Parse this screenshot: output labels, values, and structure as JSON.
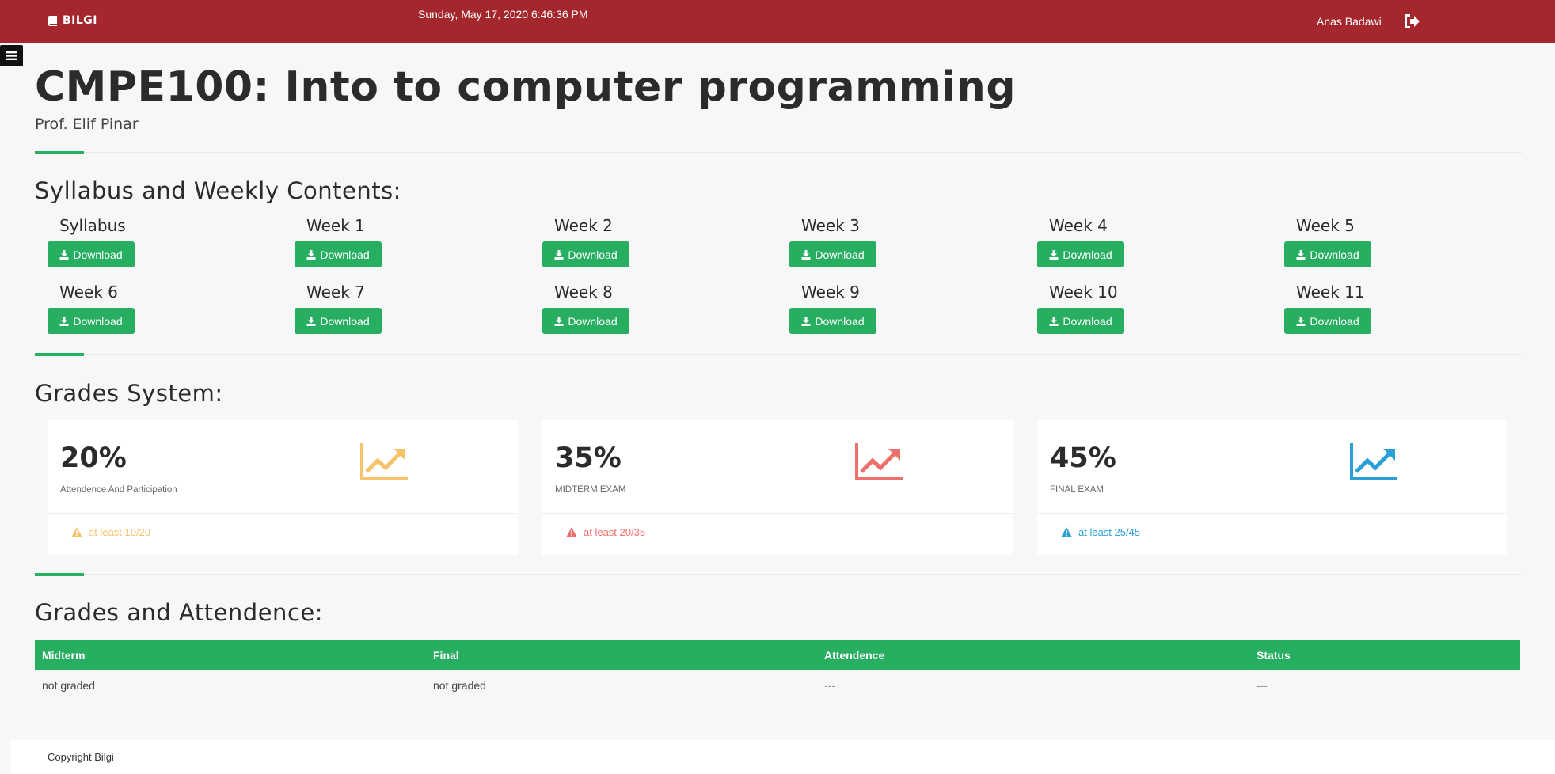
{
  "header": {
    "brand": "BILGI",
    "datetime": "Sunday, May 17, 2020 6:46:36 PM",
    "user": "Anas Badawi"
  },
  "course": {
    "title": "CMPE100: Into to computer programming",
    "professor": "Prof. Elif Pinar"
  },
  "syllabus": {
    "heading": "Syllabus and Weekly Contents:",
    "button_label": "Download",
    "items": [
      "Syllabus",
      "Week 1",
      "Week 2",
      "Week 3",
      "Week 4",
      "Week 5",
      "Week 6",
      "Week 7",
      "Week 8",
      "Week 9",
      "Week 10",
      "Week 11"
    ]
  },
  "grades_system": {
    "heading": "Grades System:",
    "cards": [
      {
        "percent": "20%",
        "label": "Attendence And Participation",
        "note": "at least 10/20",
        "color": "#f6c36b",
        "icon": "line-chart-icon"
      },
      {
        "percent": "35%",
        "label": "MIDTERM EXAM",
        "note": "at least 20/35",
        "color": "#ef6f6c",
        "icon": "line-chart-icon"
      },
      {
        "percent": "45%",
        "label": "FINAL EXAM",
        "note": "at least 25/45",
        "color": "#2a9fd6",
        "icon": "line-chart-icon"
      }
    ]
  },
  "grades_attendance": {
    "heading": "Grades and Attendence:",
    "columns": [
      "Midterm",
      "Final",
      "Attendence",
      "Status"
    ],
    "row": [
      "not graded",
      "not graded",
      "---",
      "---"
    ]
  },
  "footer": {
    "copyright": "Copyright Bilgi"
  },
  "colors": {
    "topbar": "#a4272d",
    "accent": "#27ae60"
  }
}
